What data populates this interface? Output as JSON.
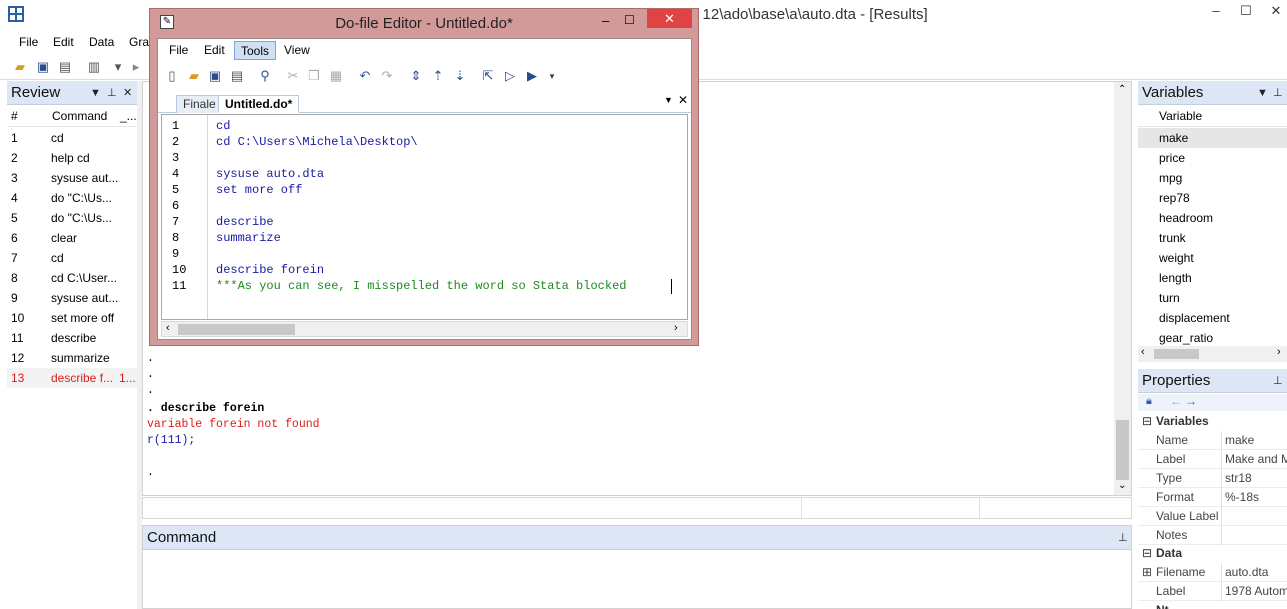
{
  "main_window": {
    "title_fragment": "a 12\\ado\\base\\a\\auto.dta - [Results]",
    "menu": [
      "File",
      "Edit",
      "Data",
      "Grap"
    ]
  },
  "review": {
    "title": "Review",
    "columns": [
      "#",
      "Command",
      "_..."
    ],
    "rows": [
      {
        "num": "1",
        "command": "cd"
      },
      {
        "num": "2",
        "command": "help cd"
      },
      {
        "num": "3",
        "command": "sysuse aut..."
      },
      {
        "num": "4",
        "command": "do \"C:\\Us..."
      },
      {
        "num": "5",
        "command": "do \"C:\\Us..."
      },
      {
        "num": "6",
        "command": "clear"
      },
      {
        "num": "7",
        "command": "cd"
      },
      {
        "num": "8",
        "command": "cd C:\\User..."
      },
      {
        "num": "9",
        "command": "sysuse aut..."
      },
      {
        "num": "10",
        "command": "set more off"
      },
      {
        "num": "11",
        "command": "describe"
      },
      {
        "num": "12",
        "command": "summarize"
      },
      {
        "num": "13",
        "command": "describe f...",
        "rc": "1..."
      }
    ],
    "error_color": "#e01b1b"
  },
  "results": {
    "lines": [
      ".",
      ".",
      ".",
      ". describe forein",
      "variable forein not found",
      "r(111);",
      "."
    ]
  },
  "command_panel": {
    "title": "Command"
  },
  "variables": {
    "title": "Variables",
    "column": "Variable",
    "items": [
      "make",
      "price",
      "mpg",
      "rep78",
      "headroom",
      "trunk",
      "weight",
      "length",
      "turn",
      "displacement",
      "gear_ratio"
    ]
  },
  "properties": {
    "title": "Properties",
    "variables_section": "Variables",
    "variables_rows": [
      {
        "label": "Name",
        "value": "make"
      },
      {
        "label": "Label",
        "value": "Make and M"
      },
      {
        "label": "Type",
        "value": "str18"
      },
      {
        "label": "Format",
        "value": "%-18s"
      },
      {
        "label": "Value Label",
        "value": ""
      },
      {
        "label": "Notes",
        "value": ""
      }
    ],
    "data_section": "Data",
    "data_rows": [
      {
        "label": "Filename",
        "value": "auto.dta"
      },
      {
        "label": "Label",
        "value": "1978 Autom"
      }
    ],
    "cut_label": "Nt"
  },
  "editor": {
    "title": "Do-file Editor - Untitled.do*",
    "menu": [
      "File",
      "Edit",
      "Tools",
      "View"
    ],
    "active_menu": "Tools",
    "tabs": [
      "Finale",
      "Untitled.do*"
    ],
    "active_tab": "Untitled.do*",
    "code_lines": [
      {
        "n": "1",
        "text": "cd",
        "style": "kw"
      },
      {
        "n": "2",
        "text": "cd C:\\Users\\Michela\\Desktop\\",
        "style": "kw"
      },
      {
        "n": "3",
        "text": "",
        "style": "kw"
      },
      {
        "n": "4",
        "text": "sysuse auto.dta",
        "style": "kw"
      },
      {
        "n": "5",
        "text": "set more off",
        "style": "kw"
      },
      {
        "n": "6",
        "text": "",
        "style": "kw"
      },
      {
        "n": "7",
        "text": "describe",
        "style": "kw"
      },
      {
        "n": "8",
        "text": "summarize",
        "style": "kw"
      },
      {
        "n": "9",
        "text": "",
        "style": "kw"
      },
      {
        "n": "10",
        "text": "describe forein",
        "style": "kw"
      },
      {
        "n": "11",
        "text": "***As you can see, I misspelled the word so Stata blocked",
        "style": "cm"
      }
    ]
  },
  "icons": {
    "app": "stata-grid-icon",
    "editor": "pencil-notepad-icon"
  },
  "colors": {
    "editor_frame": "#d39a9a",
    "close_button": "#e04343",
    "panel_header": "#dce6f4",
    "keyword": "#1a1aa6",
    "comment": "#1f8a1f",
    "error": "#e01b1b",
    "results_link": "#1a1aa6"
  }
}
